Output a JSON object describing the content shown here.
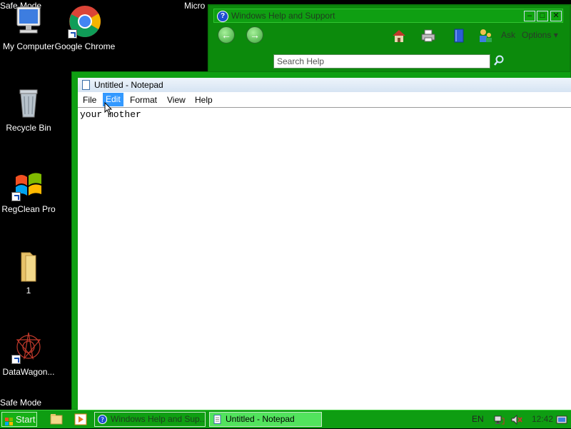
{
  "desktop": {
    "safe_mode_top": "Safe Mode",
    "safe_mode_bottom": "Safe Mode",
    "partial_label": "Micro",
    "icons": [
      {
        "label": "My Computer",
        "icon": "computer-icon"
      },
      {
        "label": "Google Chrome",
        "icon": "chrome-icon"
      },
      {
        "label": "Recycle Bin",
        "icon": "recycle-bin-icon"
      },
      {
        "label": "RegClean Pro",
        "icon": "regclean-icon"
      },
      {
        "label": "1",
        "icon": "folder-icon"
      },
      {
        "label": "DataWagon...",
        "icon": "datawagon-icon"
      }
    ]
  },
  "help_window": {
    "title": "Windows Help and Support",
    "search_placeholder": "Search Help",
    "ask_label": "Ask",
    "options_label": "Options"
  },
  "notepad": {
    "title": "Untitled - Notepad",
    "menu": [
      "File",
      "Edit",
      "Format",
      "View",
      "Help"
    ],
    "selected_menu": "Edit",
    "content": "your mother"
  },
  "taskbar": {
    "start_label": "Start",
    "tasks": [
      "Windows Help and Sup...",
      "Untitled - Notepad"
    ],
    "language": "EN",
    "clock": "12:42"
  },
  "colors": {
    "accent": "#0f9f12",
    "menu_selected": "#3399ff"
  }
}
